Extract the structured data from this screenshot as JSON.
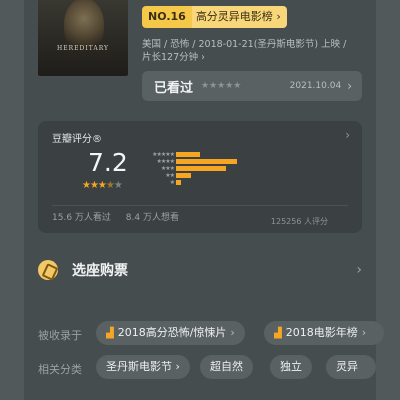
{
  "poster": {
    "title": "HEREDITARY"
  },
  "rank": {
    "no": "NO.16",
    "name": "高分灵异电影榜",
    "chevron": "›"
  },
  "meta": {
    "line1": "美国 / 恐怖 / 2018-01-21(圣丹斯电影节) 上映 /",
    "line2": "片长127分钟 ›"
  },
  "seen": {
    "label": "已看过",
    "stars": "★★★★★",
    "date": "2021.10.04",
    "chevron": "›"
  },
  "rating": {
    "title": "豆瓣评分®",
    "score": "7.2",
    "stars_on": "★★★",
    "stars_half": "★",
    "stars_off": "★",
    "count": "125256 人评分",
    "seen": "15.6 万人看过",
    "want": "8.4 万人想看",
    "distribution": [
      {
        "stars": "★★★★★",
        "fraction": 0.16
      },
      {
        "stars": "★★★★",
        "fraction": 0.4
      },
      {
        "stars": "★★★",
        "fraction": 0.33
      },
      {
        "stars": "★★",
        "fraction": 0.1
      },
      {
        "stars": "★",
        "fraction": 0.03
      }
    ],
    "chevron": "›"
  },
  "ticket": {
    "label": "选座购票",
    "chevron": "›"
  },
  "included": {
    "label": "被收录于",
    "items": [
      {
        "text": "2018高分恐怖/惊悚片",
        "chevron": "›"
      },
      {
        "text": "2018电影年榜",
        "chevron": "›"
      }
    ]
  },
  "categories": {
    "label": "相关分类",
    "items": [
      "圣丹斯电影节 ›",
      "超自然",
      "独立",
      "灵异"
    ]
  },
  "colors": {
    "accent": "#f6a623",
    "rank_bg": "#f6c84a",
    "card_bg": "#3b4142"
  }
}
